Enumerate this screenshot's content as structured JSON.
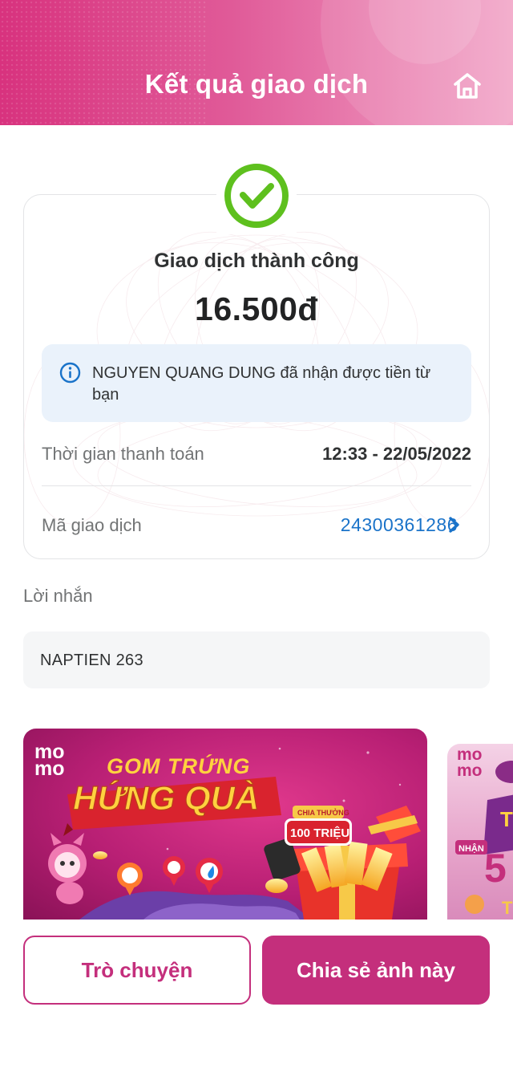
{
  "header": {
    "title": "Kết quả giao dịch",
    "home_icon": "home-icon"
  },
  "result": {
    "status_icon": "check-circle-icon",
    "status": "Giao dịch thành công",
    "amount": "16.500đ",
    "info_icon": "info-icon",
    "info_text": "NGUYEN QUANG DUNG đã nhận được tiền từ bạn",
    "time_label": "Thời gian thanh toán",
    "time_value": "12:33 - 22/05/2022",
    "txid_label": "Mã giao dịch",
    "txid_value": "24300361286"
  },
  "message": {
    "label": "Lời nhắn",
    "value": "NAPTIEN 263"
  },
  "promo": {
    "brand_top": "mo",
    "brand_bottom": "mo",
    "headline_1": "GOM TRỨNG",
    "headline_2": "HỨNG QUÀ",
    "ribbon_1": "CHIA THƯỞNG",
    "ribbon_2": "100 TRIỆU",
    "side_text_1": "T",
    "side_text_2": "NHẬN",
    "side_text_3": "5",
    "side_text_4": "T"
  },
  "buttons": {
    "chat": "Trò chuyện",
    "share": "Chia sẻ ảnh này"
  },
  "colors": {
    "brand": "#c42f7c",
    "success": "#5ec01e",
    "link": "#1a73c9"
  }
}
